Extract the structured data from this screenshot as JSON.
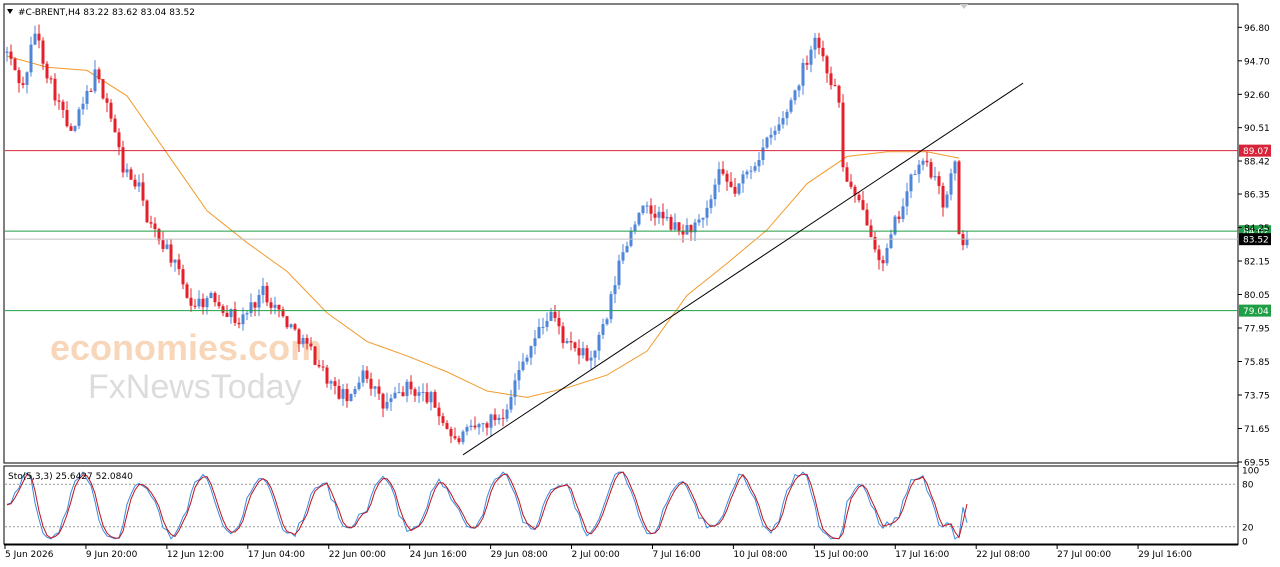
{
  "header": {
    "symbol_line": "#C-BRENT,H4  83.22 83.62 83.04 83.52"
  },
  "watermark": {
    "line1": "economies.com",
    "line2": "FxNewsToday"
  },
  "colors": {
    "bull": "#4f86d8",
    "bear": "#e3202b",
    "ma": "#f39a2b",
    "resistance": "#d8243a",
    "support": "#1e9e45",
    "trendline": "#000000",
    "stoch_main": "#3a8be0",
    "stoch_signal": "#c0141f"
  },
  "chart_data": [
    {
      "type": "candlestick",
      "title": "#C-BRENT,H4",
      "ohlc_last": {
        "open": 83.22,
        "high": 83.62,
        "low": 83.04,
        "close": 83.52
      },
      "price_axis": {
        "ylim": [
          69.55,
          98.2
        ],
        "ticks": [
          "96.80",
          "94.70",
          "92.60",
          "90.51",
          "88.42",
          "86.35",
          "84.25",
          "82.15",
          "80.05",
          "77.95",
          "75.85",
          "73.75",
          "71.65",
          "69.55"
        ]
      },
      "time_axis": {
        "ticks": [
          "5 Jun 2026",
          "9 Jun 20:00",
          "12 Jun 12:00",
          "17 Jun 04:00",
          "22 Jun 00:00",
          "24 Jun 16:00",
          "29 Jun 08:00",
          "2 Jul 00:00",
          "7 Jul 16:00",
          "10 Jul 08:00",
          "15 Jul 00:00",
          "17 Jul 16:00",
          "22 Jul 08:00",
          "27 Jul 00:00",
          "29 Jul 16:00"
        ]
      },
      "levels": [
        {
          "label": "89.07",
          "value": 89.07,
          "kind": "resistance"
        },
        {
          "label": "84.02",
          "value": 84.02,
          "kind": "support"
        },
        {
          "label": "83.52",
          "value": 83.52,
          "kind": "current"
        },
        {
          "label": "79.04",
          "value": 79.04,
          "kind": "support"
        }
      ],
      "trendline": {
        "from_bar": 114,
        "from_price": 70.0,
        "to_bar": 254,
        "to_price": 93.3
      },
      "moving_average": [
        {
          "bar": 0,
          "value": 95.0
        },
        {
          "bar": 10,
          "value": 94.3
        },
        {
          "bar": 20,
          "value": 94.1
        },
        {
          "bar": 30,
          "value": 92.5
        },
        {
          "bar": 40,
          "value": 88.9
        },
        {
          "bar": 50,
          "value": 85.3
        },
        {
          "bar": 60,
          "value": 83.3
        },
        {
          "bar": 70,
          "value": 81.5
        },
        {
          "bar": 80,
          "value": 78.9
        },
        {
          "bar": 90,
          "value": 77.1
        },
        {
          "bar": 100,
          "value": 76.2
        },
        {
          "bar": 110,
          "value": 75.2
        },
        {
          "bar": 120,
          "value": 74.0
        },
        {
          "bar": 130,
          "value": 73.6
        },
        {
          "bar": 140,
          "value": 74.2
        },
        {
          "bar": 150,
          "value": 75.0
        },
        {
          "bar": 160,
          "value": 76.5
        },
        {
          "bar": 170,
          "value": 80.0
        },
        {
          "bar": 180,
          "value": 82.0
        },
        {
          "bar": 190,
          "value": 84.1
        },
        {
          "bar": 200,
          "value": 87.0
        },
        {
          "bar": 210,
          "value": 88.7
        },
        {
          "bar": 220,
          "value": 89.0
        },
        {
          "bar": 230,
          "value": 89.0
        },
        {
          "bar": 238,
          "value": 88.6
        }
      ],
      "path": [
        {
          "bar": 0,
          "price": 95.2
        },
        {
          "bar": 4,
          "price": 93.0
        },
        {
          "bar": 7,
          "price": 96.6
        },
        {
          "bar": 10,
          "price": 94.0
        },
        {
          "bar": 16,
          "price": 90.0
        },
        {
          "bar": 22,
          "price": 93.8
        },
        {
          "bar": 25,
          "price": 92.2
        },
        {
          "bar": 29,
          "price": 88.0
        },
        {
          "bar": 34,
          "price": 86.3
        },
        {
          "bar": 35,
          "price": 84.5
        },
        {
          "bar": 40,
          "price": 83.0
        },
        {
          "bar": 46,
          "price": 79.5
        },
        {
          "bar": 52,
          "price": 79.8
        },
        {
          "bar": 58,
          "price": 78.3
        },
        {
          "bar": 64,
          "price": 80.3
        },
        {
          "bar": 70,
          "price": 78.3
        },
        {
          "bar": 76,
          "price": 76.5
        },
        {
          "bar": 82,
          "price": 74.0
        },
        {
          "bar": 86,
          "price": 73.4
        },
        {
          "bar": 89,
          "price": 75.5
        },
        {
          "bar": 94,
          "price": 73.0
        },
        {
          "bar": 100,
          "price": 74.2
        },
        {
          "bar": 106,
          "price": 73.5
        },
        {
          "bar": 112,
          "price": 70.8
        },
        {
          "bar": 116,
          "price": 71.5
        },
        {
          "bar": 124,
          "price": 72.6
        },
        {
          "bar": 130,
          "price": 76.5
        },
        {
          "bar": 136,
          "price": 79.0
        },
        {
          "bar": 140,
          "price": 76.8
        },
        {
          "bar": 146,
          "price": 76.0
        },
        {
          "bar": 150,
          "price": 78.5
        },
        {
          "bar": 153,
          "price": 82.0
        },
        {
          "bar": 158,
          "price": 85.4
        },
        {
          "bar": 163,
          "price": 85.0
        },
        {
          "bar": 168,
          "price": 84.0
        },
        {
          "bar": 174,
          "price": 84.5
        },
        {
          "bar": 178,
          "price": 87.5
        },
        {
          "bar": 182,
          "price": 86.5
        },
        {
          "bar": 188,
          "price": 88.8
        },
        {
          "bar": 194,
          "price": 91.0
        },
        {
          "bar": 198,
          "price": 93.5
        },
        {
          "bar": 202,
          "price": 96.3
        },
        {
          "bar": 206,
          "price": 93.5
        },
        {
          "bar": 208,
          "price": 92.2
        },
        {
          "bar": 209,
          "price": 88.0
        },
        {
          "bar": 212,
          "price": 86.0
        },
        {
          "bar": 215,
          "price": 84.8
        },
        {
          "bar": 219,
          "price": 81.8
        },
        {
          "bar": 222,
          "price": 84.5
        },
        {
          "bar": 227,
          "price": 87.8
        },
        {
          "bar": 230,
          "price": 88.4
        },
        {
          "bar": 234,
          "price": 85.8
        },
        {
          "bar": 237,
          "price": 88.2
        },
        {
          "bar": 238,
          "price": 83.5
        },
        {
          "bar": 240,
          "price": 83.5
        }
      ]
    },
    {
      "type": "line",
      "title": "Sto(5,3,3) 25.6427 52.0840",
      "oscillator": {
        "name": "Sto(5,3,3)",
        "main": 25.6427,
        "signal": 52.084
      },
      "ylim": [
        0,
        100
      ],
      "ticks": [
        "100",
        "80",
        "20",
        "0"
      ],
      "levels": [
        80,
        20
      ]
    }
  ]
}
